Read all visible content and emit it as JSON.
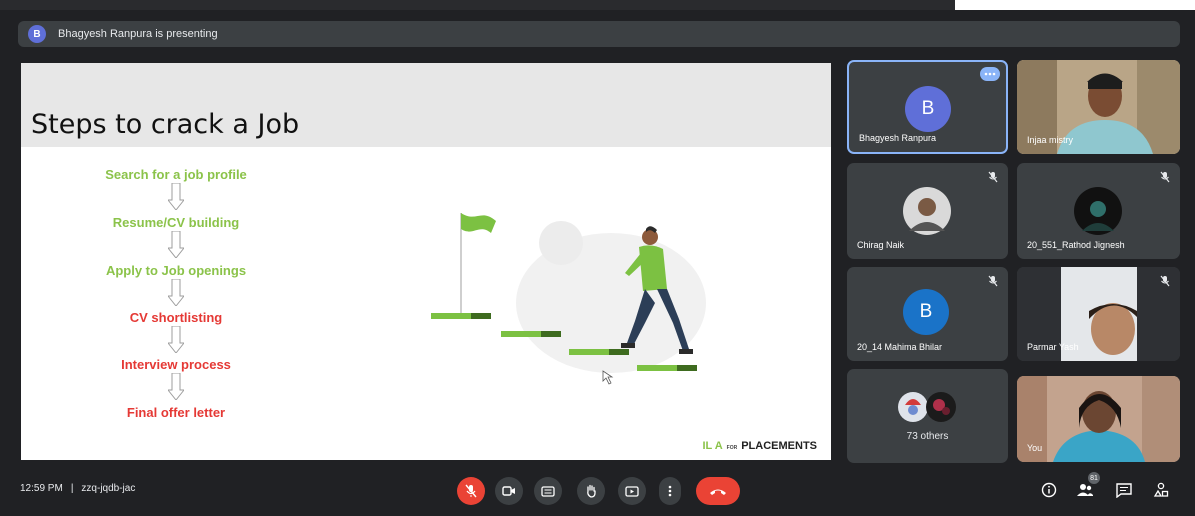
{
  "presenting": {
    "avatar_letter": "B",
    "text": "Bhagyesh Ranpura is presenting"
  },
  "slide": {
    "title": "Steps to crack a Job",
    "steps": [
      {
        "text": "Search for a job profile",
        "color": "#8bc34a"
      },
      {
        "text": "Resume/CV building",
        "color": "#8bc34a"
      },
      {
        "text": "Apply to Job openings",
        "color": "#8bc34a"
      },
      {
        "text": "CV shortlisting",
        "color": "#e53935"
      },
      {
        "text": "Interview process",
        "color": "#e53935"
      },
      {
        "text": "Final offer letter",
        "color": "#e53935"
      }
    ],
    "brand_prefix": "IL A",
    "brand_small": "FOR",
    "brand_suffix": "PLACEMENTS"
  },
  "participants": [
    {
      "name": "Bhagyesh Ranpura",
      "avatar_letter": "B",
      "avatar_color": "#5f6fd8"
    },
    {
      "name": "Injaa mistry"
    },
    {
      "name": "Chirag Naik"
    },
    {
      "name": "20_551_Rathod Jignesh"
    },
    {
      "name": "20_14 Mahima Bhilar",
      "avatar_letter": "B",
      "avatar_color": "#1a73c8"
    },
    {
      "name": "Parmar Yash"
    },
    {
      "name": "73 others"
    },
    {
      "name": "You"
    }
  ],
  "bottom": {
    "time": "12:59 PM",
    "separator": "|",
    "meeting_code": "zzq-jqdb-jac",
    "people_count": "81"
  },
  "colors": {
    "background": "#202124",
    "tile": "#3c4043",
    "accent_blue": "#8ab4f8",
    "red": "#ea4335",
    "green": "#8bc34a"
  }
}
